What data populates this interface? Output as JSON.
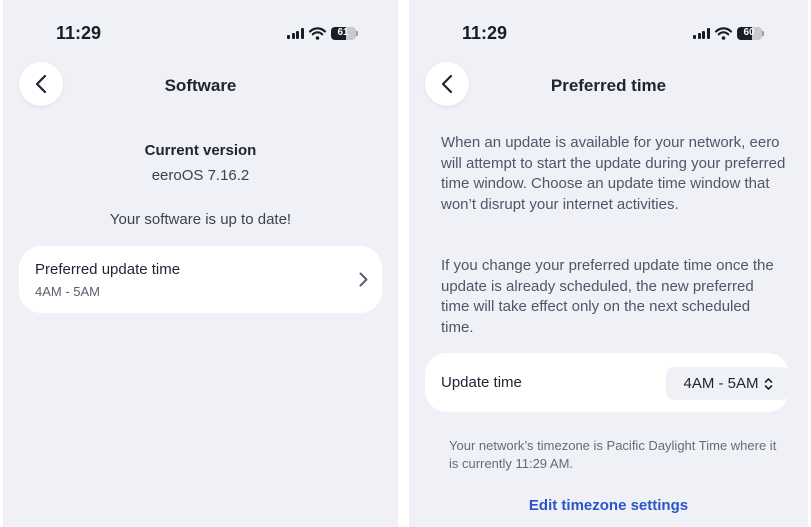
{
  "left_screen": {
    "status": {
      "time": "11:29",
      "battery": "61",
      "battery_level": 0.61
    },
    "nav": {
      "title": "Software"
    },
    "current_version": {
      "label": "Current version",
      "value": "eeroOS 7.16.2"
    },
    "status_message": "Your software is up to date!",
    "preferred_card": {
      "title": "Preferred update time",
      "value": "4AM - 5AM"
    }
  },
  "right_screen": {
    "status": {
      "time": "11:29",
      "battery": "60",
      "battery_level": 0.6
    },
    "nav": {
      "title": "Preferred time"
    },
    "description_1": "When an update is available for your network, eero will attempt to start the update during your preferred time window. Choose an update time window that won’t disrupt your internet activities.",
    "description_2": "If you change your preferred update time once the update is already scheduled, the new preferred time will take effect only on the next scheduled time.",
    "update_time": {
      "label": "Update time",
      "value": "4AM - 5AM"
    },
    "timezone_note": "Your network’s timezone is Pacific Daylight Time where it is currently 11:29 AM.",
    "edit_timezone_link": "Edit timezone settings"
  },
  "colors": {
    "background": "#eff1f6",
    "card": "#ffffff",
    "text_primary": "#1f2433",
    "text_secondary": "#50566a",
    "link": "#2b55c8"
  },
  "icons": {
    "back": "chevron-left-icon",
    "row_disclosure": "chevron-right-icon",
    "select": "chevron-up-down-icon",
    "signal": "cellular-signal-icon",
    "wifi": "wifi-icon",
    "battery": "battery-icon"
  }
}
